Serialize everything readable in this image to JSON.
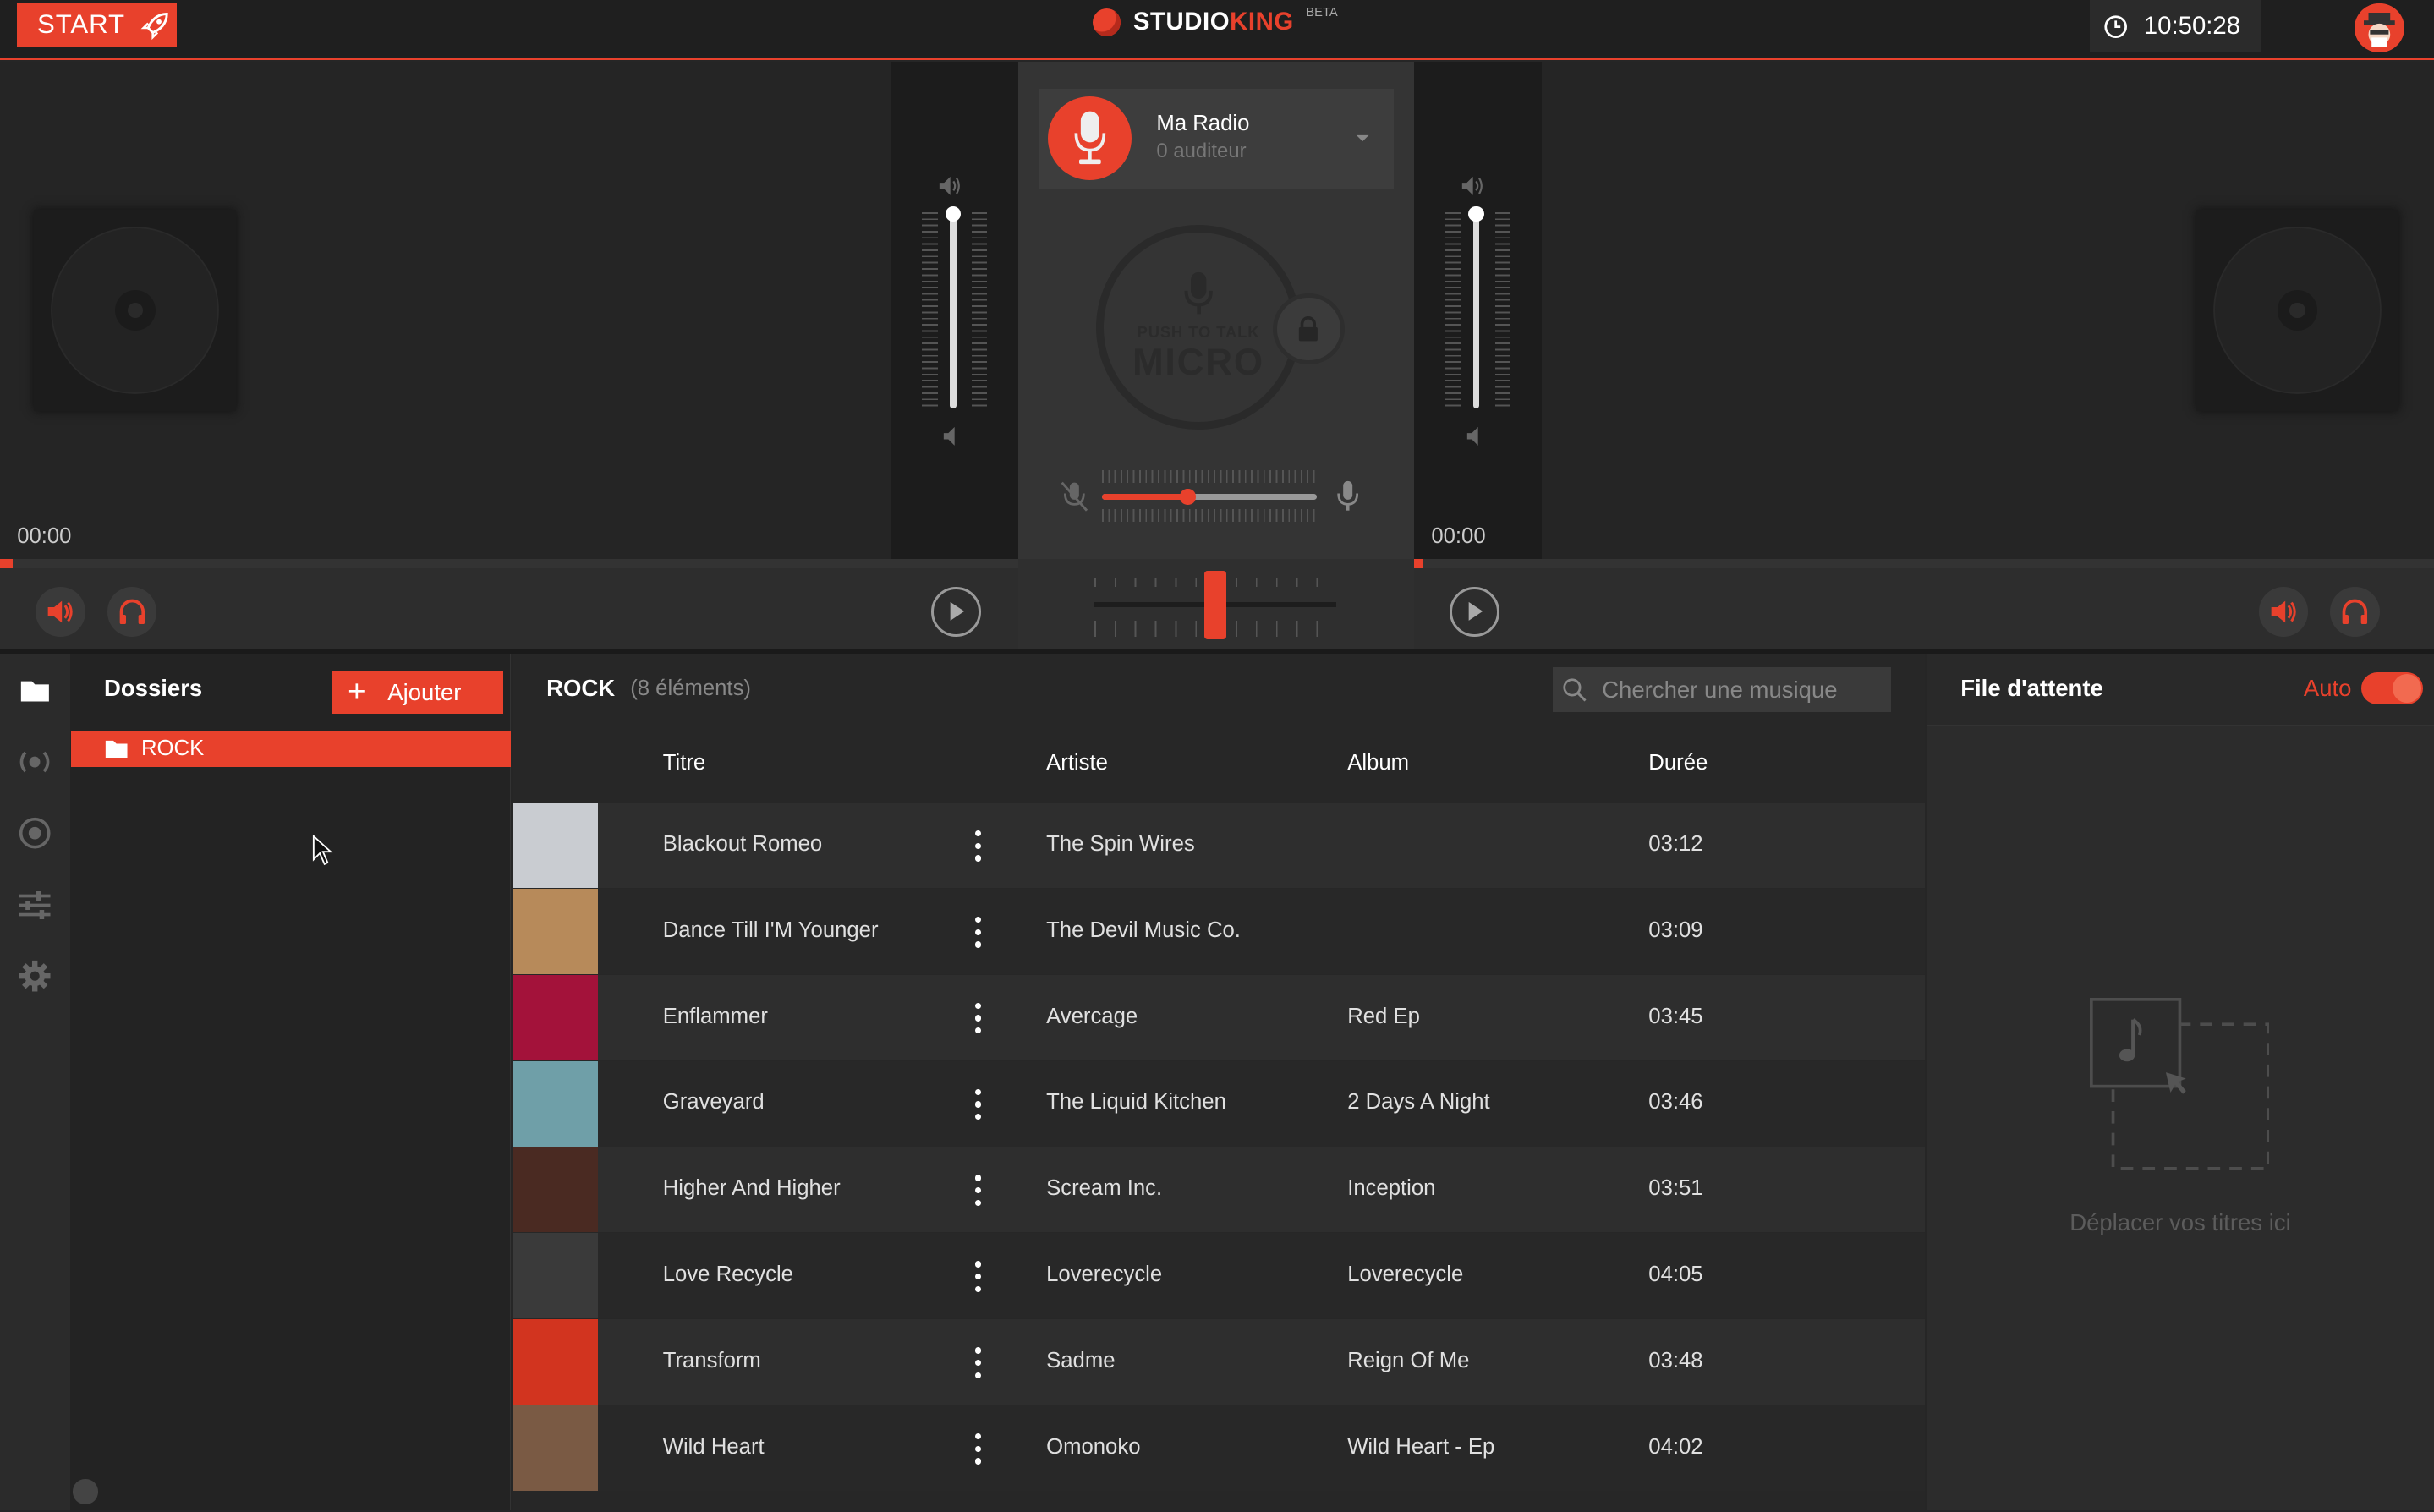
{
  "topbar": {
    "start_label": "START",
    "logo_part1": "STUDIO",
    "logo_part2": "KING",
    "logo_badge": "BETA",
    "clock": "10:50:28"
  },
  "decks": {
    "left_time": "00:00",
    "right_time": "00:00"
  },
  "center": {
    "radio_name": "Ma Radio",
    "radio_listeners": "0 auditeur",
    "mic_line1": "PUSH TO TALK",
    "mic_line2": "MICRO",
    "mic_level": 0.4,
    "crossfader_position": 0.5
  },
  "folders": {
    "title": "Dossiers",
    "add_label": "Ajouter",
    "items": [
      {
        "label": "ROCK"
      }
    ]
  },
  "tracklist": {
    "folder": "ROCK",
    "count": "(8 éléments)",
    "search_placeholder": "Chercher une musique",
    "columns": {
      "title": "Titre",
      "artist": "Artiste",
      "album": "Album",
      "duration": "Durée"
    },
    "rows": [
      {
        "title": "Blackout Romeo",
        "artist": "The Spin Wires",
        "album": "",
        "duration": "03:12",
        "cover_color": "#c9ccd1"
      },
      {
        "title": "Dance Till I'M Younger",
        "artist": "The Devil Music Co.",
        "album": "",
        "duration": "03:09",
        "cover_color": "#b78a5a"
      },
      {
        "title": "Enflammer",
        "artist": "Avercage",
        "album": "Red Ep",
        "duration": "03:45",
        "cover_color": "#a3123a"
      },
      {
        "title": "Graveyard",
        "artist": "The Liquid Kitchen",
        "album": "2 Days A Night",
        "duration": "03:46",
        "cover_color": "#6f9fa8"
      },
      {
        "title": "Higher And Higher",
        "artist": "Scream Inc.",
        "album": "Inception",
        "duration": "03:51",
        "cover_color": "#4a2a22"
      },
      {
        "title": "Love Recycle",
        "artist": "Loverecycle",
        "album": "Loverecycle",
        "duration": "04:05",
        "cover_color": "#3a3a3a"
      },
      {
        "title": "Transform",
        "artist": "Sadme",
        "album": "Reign Of Me",
        "duration": "03:48",
        "cover_color": "#d2341f"
      },
      {
        "title": "Wild Heart",
        "artist": "Omonoko",
        "album": "Wild Heart - Ep",
        "duration": "04:02",
        "cover_color": "#7a5a44"
      }
    ]
  },
  "queue": {
    "title": "File d'attente",
    "auto_label": "Auto",
    "empty_text": "Déplacer vos titres ici"
  },
  "colors": {
    "accent": "#e8412c"
  }
}
